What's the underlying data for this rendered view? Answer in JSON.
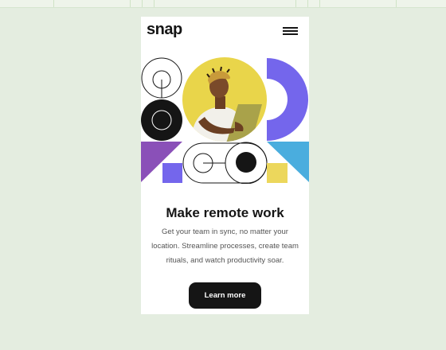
{
  "brand": {
    "name": "snap"
  },
  "header": {
    "menu_icon": "hamburger-menu-icon"
  },
  "hero": {
    "image_subject": "person-with-laptop-illustration",
    "colors": {
      "yellow": "#e9d54a",
      "purple": "#8a50b8",
      "indigo": "#7466ec",
      "blue": "#4aadde",
      "black": "#151515",
      "light_yellow": "#ecd75c"
    }
  },
  "content": {
    "headline": "Make remote work",
    "description": "Get your team in sync, no matter your location. Streamline processes, create team rituals, and watch productivity soar.",
    "cta_label": "Learn more"
  }
}
